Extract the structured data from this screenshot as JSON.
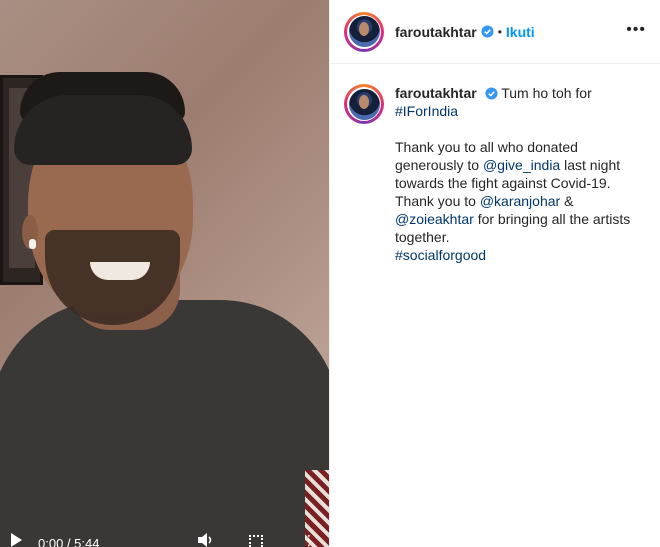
{
  "video": {
    "time": "0:00 / 5:44"
  },
  "post": {
    "username": "faroutakhtar",
    "follow_label": "Ikuti",
    "separator": "•",
    "more_label": "•••"
  },
  "caption": {
    "username": "faroutakhtar",
    "line1": "Tum ho toh for",
    "hashtag1": "#IForIndia",
    "p1": "Thank you to all who donated generously to ",
    "mention1": "@give_india",
    "p2": " last night towards the fight against Covid-19. Thank you to ",
    "mention2": "@karanjohar",
    "p3": " & ",
    "mention3": "@zoieakhtar",
    "p4": " for bringing all the artists together.",
    "hashtag2": "#socialforgood"
  },
  "icons": {
    "verified": "verified-badge-icon",
    "more": "more-options-icon",
    "play": "play-icon",
    "volume": "volume-icon",
    "fullscreen": "fullscreen-icon"
  },
  "colors": {
    "link": "#00376b",
    "follow": "#0095f6",
    "verified": "#3897f0"
  }
}
